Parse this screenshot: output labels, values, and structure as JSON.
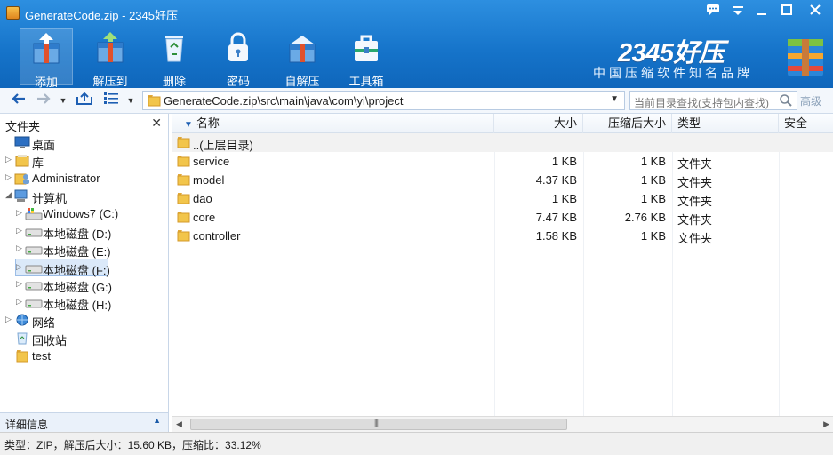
{
  "window": {
    "title": "GenerateCode.zip - 2345好压",
    "controls": [
      "feedback-icon",
      "menu-icon",
      "minimize-icon",
      "maximize-icon",
      "close-icon"
    ]
  },
  "toolbar": {
    "items": [
      {
        "label": "添加",
        "icon": "add-box-icon",
        "active": true
      },
      {
        "label": "解压到",
        "icon": "extract-box-icon",
        "active": false
      },
      {
        "label": "删除",
        "icon": "recycle-bin-icon",
        "active": false
      },
      {
        "label": "密码",
        "icon": "lock-icon",
        "active": false
      },
      {
        "label": "自解压",
        "icon": "self-extract-icon",
        "active": false
      },
      {
        "label": "工具箱",
        "icon": "toolbox-icon",
        "active": false
      }
    ],
    "brand_title": "2345好压",
    "brand_subtitle": "中国压缩软件知名品牌"
  },
  "address": {
    "path": "GenerateCode.zip\\src\\main\\java\\com\\yi\\project",
    "search_placeholder": "当前目录查找(支持包内查找)",
    "advanced_label": "高级"
  },
  "sidebar": {
    "title": "文件夹",
    "items": [
      {
        "label": "桌面",
        "icon": "desktop-icon",
        "indent": 0,
        "arrow": ""
      },
      {
        "label": "库",
        "icon": "library-icon",
        "indent": 0,
        "arrow": "▷"
      },
      {
        "label": "Administrator",
        "icon": "user-folder-icon",
        "indent": 0,
        "arrow": "▷"
      },
      {
        "label": "计算机",
        "icon": "computer-icon",
        "indent": 0,
        "arrow": "◢"
      },
      {
        "label": "Windows7 (C:)",
        "icon": "system-drive-icon",
        "indent": 1,
        "arrow": "▷"
      },
      {
        "label": "本地磁盘 (D:)",
        "icon": "drive-icon",
        "indent": 1,
        "arrow": "▷"
      },
      {
        "label": "本地磁盘 (E:)",
        "icon": "drive-icon",
        "indent": 1,
        "arrow": "▷"
      },
      {
        "label": "本地磁盘 (F:)",
        "icon": "drive-icon",
        "indent": 1,
        "arrow": "▷",
        "selected": true
      },
      {
        "label": "本地磁盘 (G:)",
        "icon": "drive-icon",
        "indent": 1,
        "arrow": "▷"
      },
      {
        "label": "本地磁盘 (H:)",
        "icon": "drive-icon",
        "indent": 1,
        "arrow": "▷"
      },
      {
        "label": "网络",
        "icon": "network-icon",
        "indent": 0,
        "arrow": "▷"
      },
      {
        "label": "回收站",
        "icon": "recycle-bin-icon",
        "indent": 0,
        "arrow": ""
      },
      {
        "label": "test",
        "icon": "folder-icon",
        "indent": 0,
        "arrow": ""
      }
    ],
    "detail_label": "详细信息"
  },
  "filelist": {
    "columns": [
      "名称",
      "大小",
      "压缩后大小",
      "类型",
      "安全"
    ],
    "parent_label": "..(上层目录)",
    "rows": [
      {
        "name": "service",
        "size": "1 KB",
        "packed": "1 KB",
        "type": "文件夹"
      },
      {
        "name": "model",
        "size": "4.37 KB",
        "packed": "1 KB",
        "type": "文件夹"
      },
      {
        "name": "dao",
        "size": "1 KB",
        "packed": "1 KB",
        "type": "文件夹"
      },
      {
        "name": "core",
        "size": "7.47 KB",
        "packed": "2.76 KB",
        "type": "文件夹"
      },
      {
        "name": "controller",
        "size": "1.58 KB",
        "packed": "1 KB",
        "type": "文件夹"
      }
    ]
  },
  "status": {
    "text": "类型：ZIP，解压后大小：15.60 KB，压缩比：33.12%"
  },
  "colors": {
    "toolbar_blue": "#1573c9",
    "folder_yellow": "#f2c54b",
    "selection": "#dbe9f9"
  }
}
